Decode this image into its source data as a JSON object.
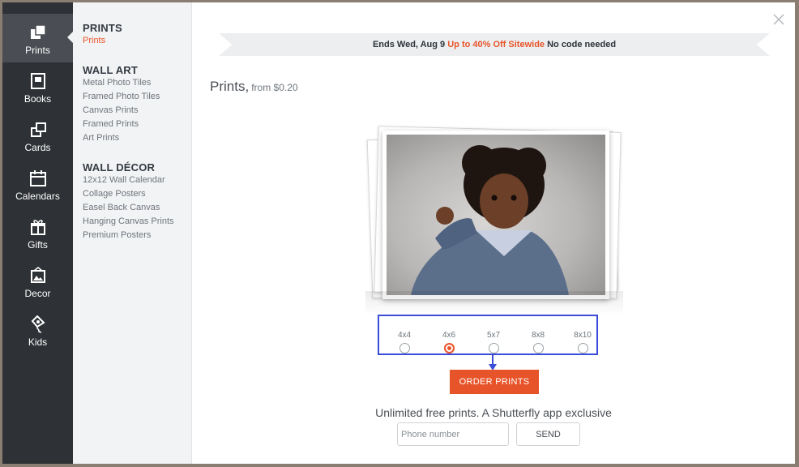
{
  "sidebar": {
    "items": [
      {
        "label": "Prints",
        "icon": "prints-icon"
      },
      {
        "label": "Books",
        "icon": "book-icon"
      },
      {
        "label": "Cards",
        "icon": "cards-icon"
      },
      {
        "label": "Calendars",
        "icon": "calendar-icon"
      },
      {
        "label": "Gifts",
        "icon": "gift-icon"
      },
      {
        "label": "Decor",
        "icon": "picture-frame-icon"
      },
      {
        "label": "Kids",
        "icon": "kite-icon"
      }
    ]
  },
  "menu": {
    "prints": {
      "heading": "PRINTS",
      "links": [
        "Prints"
      ]
    },
    "wall_art": {
      "heading": "WALL ART",
      "links": [
        "Metal Photo Tiles",
        "Framed Photo Tiles",
        "Canvas Prints",
        "Framed Prints",
        "Art Prints"
      ]
    },
    "wall_decor": {
      "heading": "WALL DÉCOR",
      "links": [
        "12x12 Wall Calendar",
        "Collage Posters",
        "Easel Back Canvas",
        "Hanging Canvas Prints",
        "Premium Posters"
      ]
    }
  },
  "banner": {
    "prefix": "Ends Wed, Aug 9",
    "promo": "Up to 40% Off Sitewide",
    "suffix": "No code needed"
  },
  "product": {
    "title": "Prints,",
    "price": "from $0.20",
    "sizes": [
      "4x4",
      "4x6",
      "5x7",
      "8x8",
      "8x10"
    ],
    "selected_size": "4x6",
    "order_label": "ORDER PRINTS"
  },
  "app_promo": {
    "text": "Unlimited free prints. A Shutterfly app exclusive",
    "phone_placeholder": "Phone number",
    "send_label": "SEND"
  },
  "colors": {
    "accent": "#e8542a",
    "rail": "#2e3135",
    "highlight_box": "#3b4cd6"
  }
}
